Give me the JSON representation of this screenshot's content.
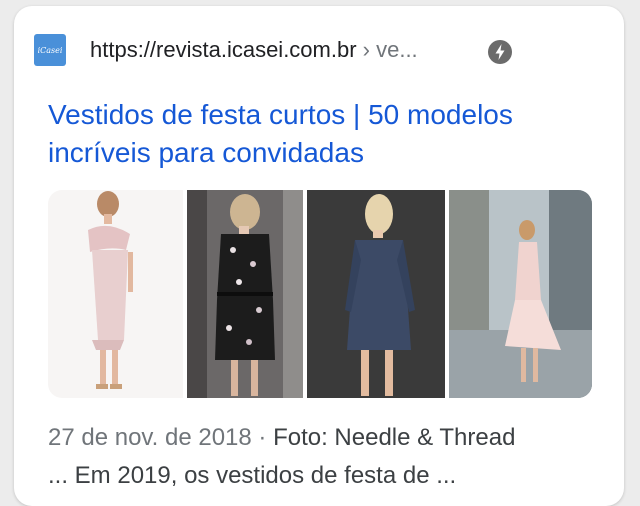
{
  "result": {
    "favicon_text": "iCasei",
    "url_domain": "https://revista.icasei.com.br",
    "url_path": " › ve...",
    "amp_icon": "lightning-bolt-icon",
    "title": "Vestidos de festa curtos | 50 modelos incríveis para convidadas",
    "images": [
      {
        "name": "pink-ruffle-dress-photo"
      },
      {
        "name": "black-floral-dress-photo"
      },
      {
        "name": "navy-sequin-dress-photo"
      },
      {
        "name": "blush-pleated-dress-photo"
      }
    ],
    "date": "27 de nov. de 2018",
    "separator": " · ",
    "photo_credit": "Foto: Needle & Thread",
    "snippet": "... Em 2019, os vestidos de festa de ..."
  },
  "colors": {
    "link_blue": "#1558d6",
    "favicon_blue": "#4a90d9",
    "meta_gray": "#70757a"
  }
}
